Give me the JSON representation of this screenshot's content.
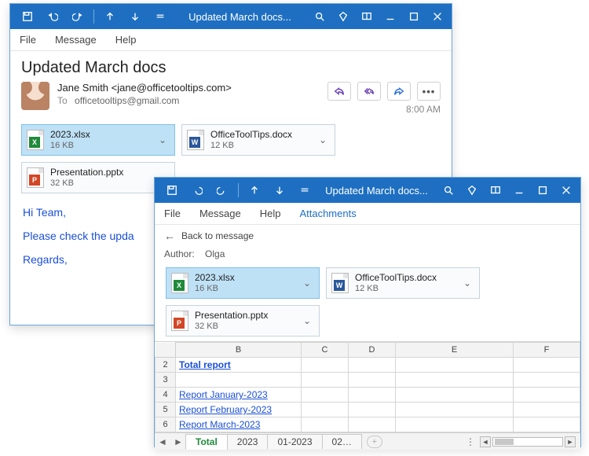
{
  "win1": {
    "title": "Updated March docs...",
    "menu": [
      "File",
      "Message",
      "Help"
    ],
    "subject": "Updated March docs",
    "from": "Jane Smith <jane@officetooltips.com>",
    "to_label": "To",
    "to": "officetooltips@gmail.com",
    "time": "8:00 AM",
    "attachments": [
      {
        "name": "2023.xlsx",
        "size": "16 KB",
        "kind": "xl",
        "selected": true
      },
      {
        "name": "OfficeToolTips.docx",
        "size": "12 KB",
        "kind": "wd",
        "selected": false
      },
      {
        "name": "Presentation.pptx",
        "size": "32 KB",
        "kind": "pp",
        "selected": false
      }
    ],
    "body": {
      "l1": "Hi Team,",
      "l2": "Please check the upda",
      "l3": "Regards,"
    }
  },
  "win2": {
    "title": "Updated March docs...",
    "menu": [
      "File",
      "Message",
      "Help",
      "Attachments"
    ],
    "menu_active_index": 3,
    "back": "Back to message",
    "author_label": "Author:",
    "author": "Olga",
    "attachments": [
      {
        "name": "2023.xlsx",
        "size": "16 KB",
        "kind": "xl",
        "selected": true
      },
      {
        "name": "OfficeToolTips.docx",
        "size": "12 KB",
        "kind": "wd",
        "selected": false
      },
      {
        "name": "Presentation.pptx",
        "size": "32 KB",
        "kind": "pp",
        "selected": false
      }
    ],
    "sheet": {
      "cols": [
        "B",
        "C",
        "D",
        "E",
        "F"
      ],
      "rows": [
        {
          "n": "2",
          "b": "Total report",
          "bold": true
        },
        {
          "n": "3",
          "b": ""
        },
        {
          "n": "4",
          "b": "Report January-2023"
        },
        {
          "n": "5",
          "b": "Report February-2023"
        },
        {
          "n": "6",
          "b": "Report March-2023"
        }
      ],
      "tabs": [
        "Total",
        "2023",
        "01-2023",
        "02…"
      ],
      "active_tab": 0
    }
  },
  "icons": {
    "ellipsis": "•••",
    "chev_down": "⌄",
    "back_arrow": "←",
    "tab_prev": "◄",
    "tab_next": "►",
    "tab_add": "+"
  }
}
